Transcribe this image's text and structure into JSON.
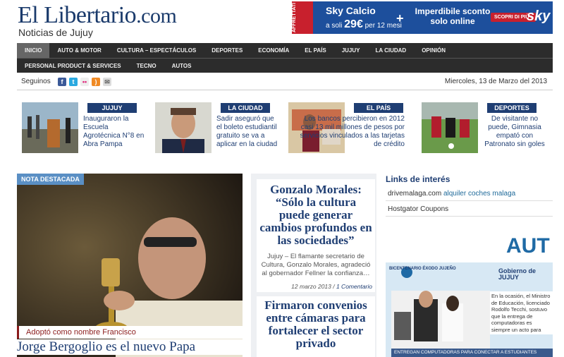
{
  "header": {
    "logo_main": "El Libertario",
    "logo_domain": ".com",
    "tagline": "Noticias de Jujuy"
  },
  "ad_sky": {
    "ribbon": "AFFRETTATI",
    "title": "Sky Calcio",
    "price_prefix": "a soli",
    "price": "29€",
    "price_suffix": "per 12 mesi",
    "plus": "+",
    "offer": "Imperdibile sconto solo online",
    "cta": "SCOPRI DI PIÙ ›",
    "brand": "sky"
  },
  "nav": {
    "row1": [
      "INICIO",
      "AUTO & MOTOR",
      "CULTURA – ESPECTÁCULOS",
      "DEPORTES",
      "ECONOMÍA",
      "EL PAÍS",
      "JUJUY",
      "LA CIUDAD",
      "OPINIÓN"
    ],
    "row2": [
      "PERSONAL PRODUCT & SERVICES",
      "TECNO",
      "AUTOS"
    ]
  },
  "social": {
    "label": "Seguinos",
    "icons": [
      "facebook-icon",
      "twitter-icon",
      "flickr-icon",
      "rss-icon",
      "email-icon"
    ],
    "date": "Miercoles, 13 de Marzo del 2013"
  },
  "news": [
    {
      "cat": "JUJUY",
      "text": "Inauguraron la Escuela Agrotécnica N°8 en Abra Pampa"
    },
    {
      "cat": "LA CIUDAD",
      "text": "Sadir aseguró que el boleto estudiantil gratuito se va a aplicar en la ciudad"
    },
    {
      "cat": "EL PAÍS",
      "text": "Los bancos percibieron en 2012 casi 13 mil millones de pesos por servicios vinculados a las tarjetas de crédito"
    },
    {
      "cat": "DEPORTES",
      "text": "De visitante no puede, Gimnasia empató con Patronato sin goles"
    }
  ],
  "featured": {
    "tag": "NOTA DESTACADA",
    "caption": "Adoptó como nombre Francisco",
    "title": "Jorge Bergoglio es el nuevo Papa"
  },
  "middle": {
    "card1": {
      "title": "Gonzalo Morales: “Sólo la cultura puede generar cambios profundos en las sociedades”",
      "body": "Jujuy – El flamante secretario de Cultura, Gonzalo Morales, agradeció al gobernador Fellner la confianza…",
      "date": "12 marzo 2013",
      "sep": " / ",
      "comments": "1 Comentario"
    },
    "card2": {
      "title": "Firmaron convenios entre cámaras para fortalecer el sector privado"
    }
  },
  "links": {
    "title": "Links de interés",
    "items": [
      {
        "a": "drivemalaga.com",
        "b": "alquiler coches malaga"
      },
      {
        "a": "Hostgator Coupons",
        "b": ""
      }
    ]
  },
  "side_ad": {
    "aut": "AUT",
    "header": "BICENTENARIO ÉXODO JUJEÑO",
    "gob": "Gobierno de JUJUY",
    "text": "En la ocasión, el Ministro de Educación, licenciado Rodolfo Tecchi, sostuvo que la entrega de computadoras es siempre un acto para",
    "banner": "ENTREGAN COMPUTADORAS PARA CONECTAR A ESTUDIANTES"
  },
  "colors": {
    "brand": "#1f3e73",
    "nav_bg": "#2c2c2c",
    "tag_blue": "#5a8fc4",
    "accent_red": "#8a1b1b"
  }
}
